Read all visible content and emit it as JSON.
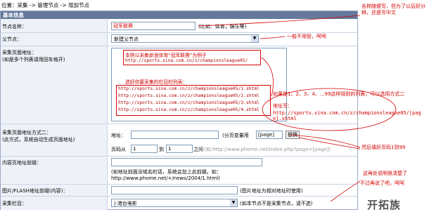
{
  "breadcrumb": "位置：采集 -> 管理节点 -> 增加节点",
  "section_title": "基本信息",
  "fields": {
    "node_name": {
      "label": "节点名称：",
      "value": "冠军联赛",
      "hint": "(比如：体育，娱乐等)"
    },
    "parent_node": {
      "label": "父节点：",
      "value": "新建父节点"
    },
    "collect_url": {
      "label": "采集页面地址：",
      "sublabel": "(如是多个列表请用回车格开)"
    },
    "collect_url2": {
      "label": "采集页面地址方式二：",
      "sublabel": "(此方式，系统自动生成页面地址)",
      "address_label": "地址：",
      "address_hint": "(分页变量用",
      "page_token": "[page]",
      "replace_button": "替换",
      "page_from_label": "页码从",
      "page_from": "1",
      "page_to_label": "到",
      "page_to": "1",
      "page_to_suffix": "之间",
      "example": "(如:http://www.phome.net/index.php?page=[page])"
    },
    "content_prefix": {
      "label": "内容页地址前缀：",
      "hint_line1": "(如地址前面没域名的话，系统会加上此前缀。如：",
      "hint_line2": "http://www.phome.net/+/news/2004/1.html)"
    },
    "image_prefix": {
      "label": "图片/FLASH地址前缀(内容)：",
      "hint": "(图片地址为相对地址时使用)"
    },
    "collect_column": {
      "label": "采集栏目：",
      "value": "|-港台电影",
      "hint": "(如本节点不是采集节点，请不选)"
    }
  },
  "textarea_notes": {
    "example_title": "本例以采集新浪体育“冠军联赛”为例子",
    "example_url": "http://sports.sina.com.cn/z/championsleague05/",
    "choose_title": "选好你要采集的栏目的列表：",
    "list_urls": [
      "http://sports.sina.com.cn/z/championsleague05/1.shtml",
      "http://sports.sina.com.cn/z/championsleague05/2.shtml",
      "http://sports.sina.com.cn/z/championsleague05/3.shtml",
      "http://sports.sina.com.cn/z/championsleague05/4.shtml"
    ]
  },
  "annotations": {
    "name_note": "名称随便写，但为了以后好分辨，还是写中文",
    "parent_note": "一般不用管，呵呵",
    "list_note": "如果是1、2、3、4、...99这样规则的列表，可以选用方式二",
    "address_note_label": "地址写：",
    "address_note_url": "http://sports.sina.com.cn/z/championsleague05/[page].shtml",
    "page_note": "然后填好页码1到99",
    "column_note_1": "这再处说明很清楚了",
    "column_note_2": "不过再说了吧，呵呵"
  },
  "watermark": "开拓族",
  "colors": {
    "header_bg": "#64799c",
    "annotation": "#d40000",
    "border": "#9aa9c3"
  }
}
